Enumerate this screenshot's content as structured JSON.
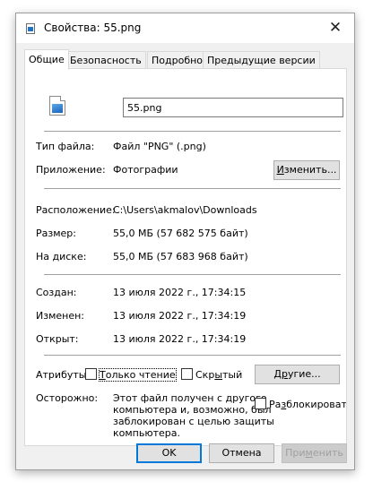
{
  "window": {
    "title": "Свойства: 55.png"
  },
  "tabs": [
    {
      "label": "Общие"
    },
    {
      "label": "Безопасность"
    },
    {
      "label": "Подробно"
    },
    {
      "label": "Предыдущие версии"
    }
  ],
  "general": {
    "file_name": "55.png",
    "type_label": "Тип файла:",
    "type_value": "Файл \"PNG\" (.png)",
    "app_label": "Приложение:",
    "app_value": "Фотографии",
    "change_button_prefix": "",
    "change_button_underlined": "И",
    "change_button_rest": "зменить...",
    "location_label": "Расположение:",
    "location_value": "C:\\Users\\akmalov\\Downloads",
    "size_label": "Размер:",
    "size_value": "55,0 МБ (57 682 575 байт)",
    "disk_label": "На диске:",
    "disk_value": "55,0 МБ (57 683 968 байт)",
    "created_label": "Создан:",
    "created_value": "13 июля 2022 г., 17:34:15",
    "modified_label": "Изменен:",
    "modified_value": "13 июля 2022 г., 17:34:19",
    "opened_label": "Открыт:",
    "opened_value": "13 июля 2022 г., 17:34:19",
    "attributes_label": "Атрибуты:",
    "readonly_prefix": "",
    "readonly_underlined": "Т",
    "readonly_rest": "олько чтение",
    "hidden_prefix": "Скр",
    "hidden_underlined": "ы",
    "hidden_rest": "тый",
    "other_prefix": "Д",
    "other_underlined": "р",
    "other_rest": "угие...",
    "caution_label": "Осторожно:",
    "caution_text_1": "Этот файл получен с другого",
    "caution_text_2": "компьютера и, возможно, был",
    "caution_text_3": "заблокирован с целью защиты",
    "caution_text_4": "компьютера.",
    "unblock_prefix": "Ра",
    "unblock_underlined": "з",
    "unblock_rest": "блокировать"
  },
  "footer": {
    "ok_label": "OK",
    "cancel_label": "Отмена",
    "apply_prefix": "При",
    "apply_underlined": "м",
    "apply_rest": "енить"
  },
  "colors": {
    "accent": "#0078d7",
    "window_bg": "#f0f0f0",
    "panel_bg": "#ffffff"
  },
  "icons": {
    "title": "png-file-icon",
    "file": "png-file-icon",
    "close": "close-icon"
  }
}
